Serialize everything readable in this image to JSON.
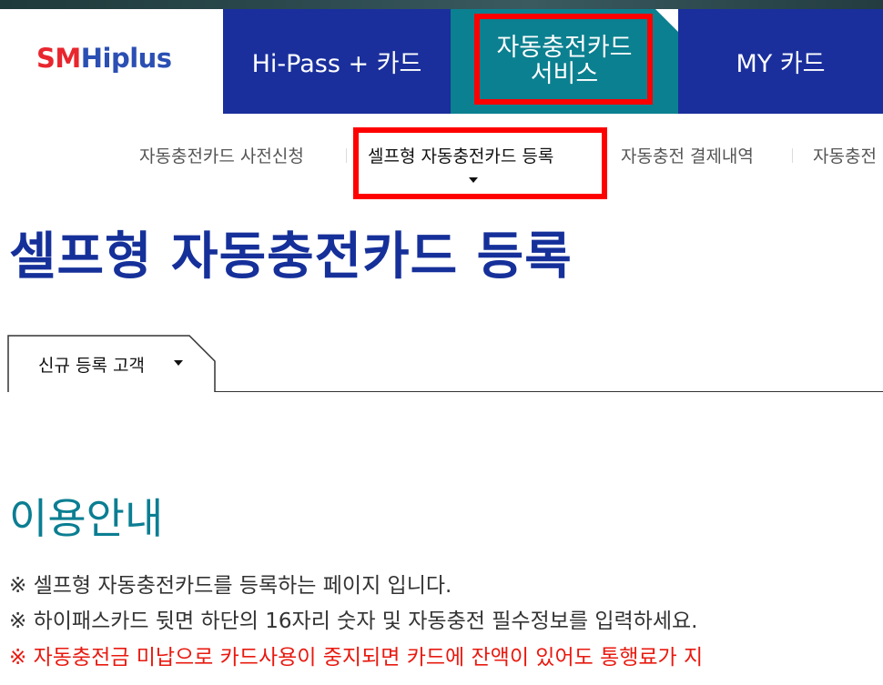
{
  "logo": {
    "part1": "SM",
    "part2": "Hiplus"
  },
  "gnb": {
    "items": [
      {
        "label": "Hi-Pass + 카드"
      },
      {
        "line1": "자동충전카드",
        "line2": "서비스"
      },
      {
        "label": "MY 카드"
      }
    ]
  },
  "subnav": {
    "items": [
      {
        "label": "자동충전카드 사전신청"
      },
      {
        "label": "셀프형 자동충전카드 등록"
      },
      {
        "label": "자동충전 결제내역"
      },
      {
        "label": "자동충전"
      }
    ]
  },
  "page": {
    "title": "셀프형 자동충전카드 등록"
  },
  "tabs": {
    "active_label": "신규 등록 고객"
  },
  "guide": {
    "title": "이용안내",
    "lines": [
      "※ 셀프형 자동충전카드를 등록하는 페이지 입니다.",
      "※ 하이패스카드 뒷면 하단의 16자리 숫자 및 자동충전 필수정보를 입력하세요.",
      "※ 자동충전금 미납으로 카드사용이 중지되면 카드에 잔액이 있어도 통행료가 지"
    ]
  },
  "colors": {
    "nav_blue": "#1a2f9c",
    "nav_teal": "#0b8090",
    "title_blue": "#16309a",
    "guide_teal": "#0b7e92",
    "warning_red": "#e8190f",
    "highlight_red": "#ff0000"
  }
}
